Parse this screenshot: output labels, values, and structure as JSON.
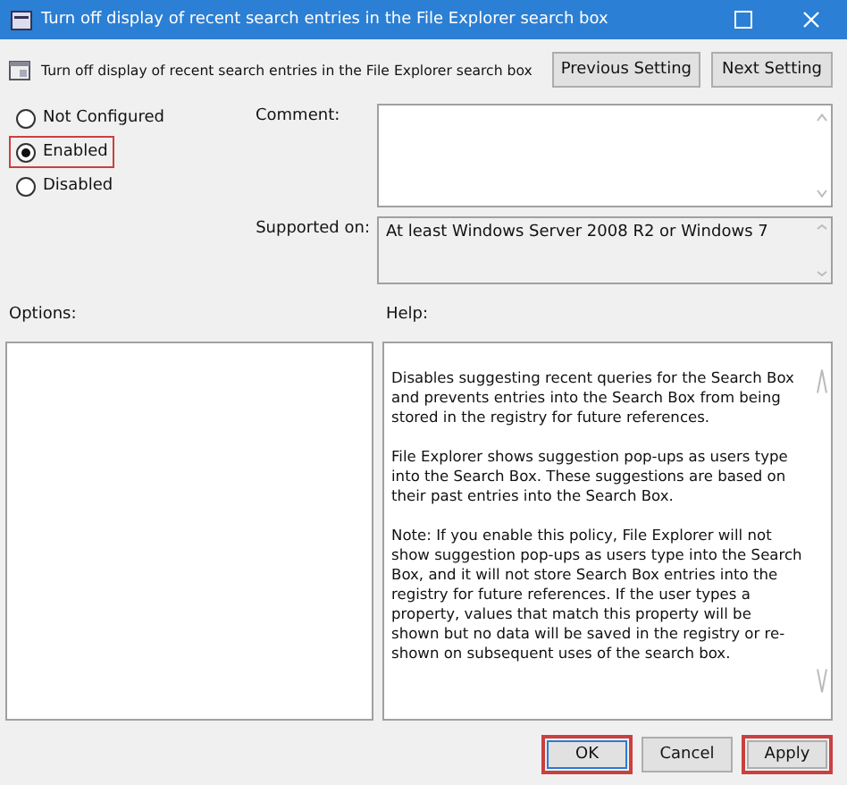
{
  "window": {
    "title": "Turn off display of recent search entries in the File Explorer search box"
  },
  "header": {
    "title": "Turn off display of recent search entries in the File Explorer search box",
    "buttons": [
      {
        "label": "Previous Setting"
      },
      {
        "label": "Next Setting"
      }
    ]
  },
  "states": [
    {
      "label": "Not Configured",
      "selected": false,
      "highlighted": false
    },
    {
      "label": "Enabled",
      "selected": true,
      "highlighted": true
    },
    {
      "label": "Disabled",
      "selected": false,
      "highlighted": false
    }
  ],
  "comment": {
    "label": "Comment:"
  },
  "supported": {
    "label": "Supported on:",
    "value": "At least Windows Server 2008 R2 or Windows 7"
  },
  "options": {
    "label": "Options:"
  },
  "help": {
    "label": "Help:",
    "paragraphs": [
      "Disables suggesting recent queries for the Search Box and prevents entries into the Search Box from being stored in the registry for future references.",
      "File Explorer shows suggestion pop-ups as users type into the Search Box.  These suggestions are based on their past entries into the Search Box.",
      "Note: If you enable this policy, File Explorer will not show suggestion pop-ups as users type into the Search Box, and it will not store Search Box entries into the registry for future references.  If the user types a property, values that match this property will be shown but no data will be saved in the registry or re-shown on subsequent uses of the search box."
    ]
  },
  "footer": {
    "buttons": [
      {
        "label": "OK",
        "default": true,
        "highlighted": true
      },
      {
        "label": "Cancel",
        "default": false,
        "highlighted": false
      },
      {
        "label": "Apply",
        "default": false,
        "highlighted": true
      }
    ]
  }
}
